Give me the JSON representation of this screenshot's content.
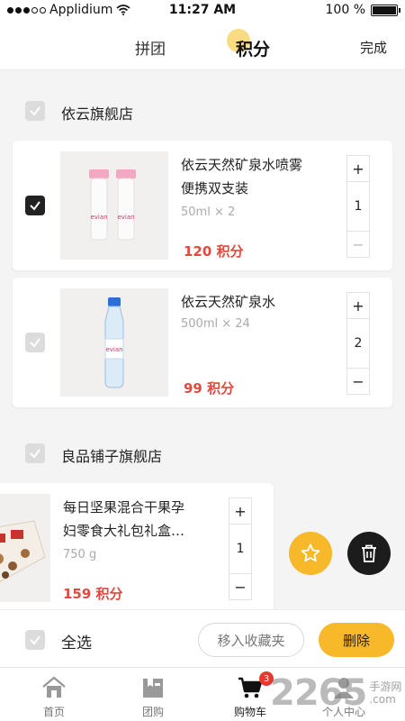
{
  "status_bar": {
    "carrier": "Applidium",
    "time": "11:27 AM",
    "battery": "100 %"
  },
  "nav": {
    "tabs": [
      "拼团",
      "积分"
    ],
    "active_tab": "积分",
    "done_label": "完成"
  },
  "stores": [
    {
      "name": "依云旗舰店",
      "selected": false,
      "items": [
        {
          "name_line1": "依云天然矿泉水喷雾",
          "name_line2": "便携双支装",
          "spec": "50ml × 2",
          "price": "120 积分",
          "qty": "1",
          "selected": true,
          "image": "evian-spray-icon"
        },
        {
          "name_line1": "依云天然矿泉水",
          "name_line2": "",
          "spec": "500ml × 24",
          "price": "99 积分",
          "qty": "2",
          "selected": false,
          "image": "evian-bottle-icon"
        }
      ]
    },
    {
      "name": "良品铺子旗舰店",
      "selected": false,
      "items": [
        {
          "name_line1": "每日坚果混合干果孕",
          "name_line2": "妇零食大礼包礼盒…",
          "spec": "750 g",
          "price": "159 积分",
          "qty": "1",
          "selected": false,
          "image": "nut-gift-box-icon"
        }
      ]
    }
  ],
  "stepper": {
    "plus": "+",
    "minus": "−"
  },
  "bottom_bar": {
    "select_all_label": "全选",
    "move_to_favorites_label": "移入收藏夹",
    "delete_label": "删除"
  },
  "tabbar": {
    "tabs": [
      {
        "label": "首页",
        "icon": "home-icon"
      },
      {
        "label": "团购",
        "icon": "group-buy-icon"
      },
      {
        "label": "购物车",
        "icon": "cart-icon",
        "badge": "3"
      },
      {
        "label": "个人中心",
        "icon": "profile-icon"
      }
    ],
    "active": "购物车"
  },
  "watermark": {
    "number": "2265",
    "site_line1": "手游网",
    "site_line2": ".com"
  },
  "colors": {
    "accent_yellow": "#f7b829",
    "price_red": "#e04a3f",
    "dark": "#1c1c1c",
    "badge_red": "#e8372d"
  }
}
